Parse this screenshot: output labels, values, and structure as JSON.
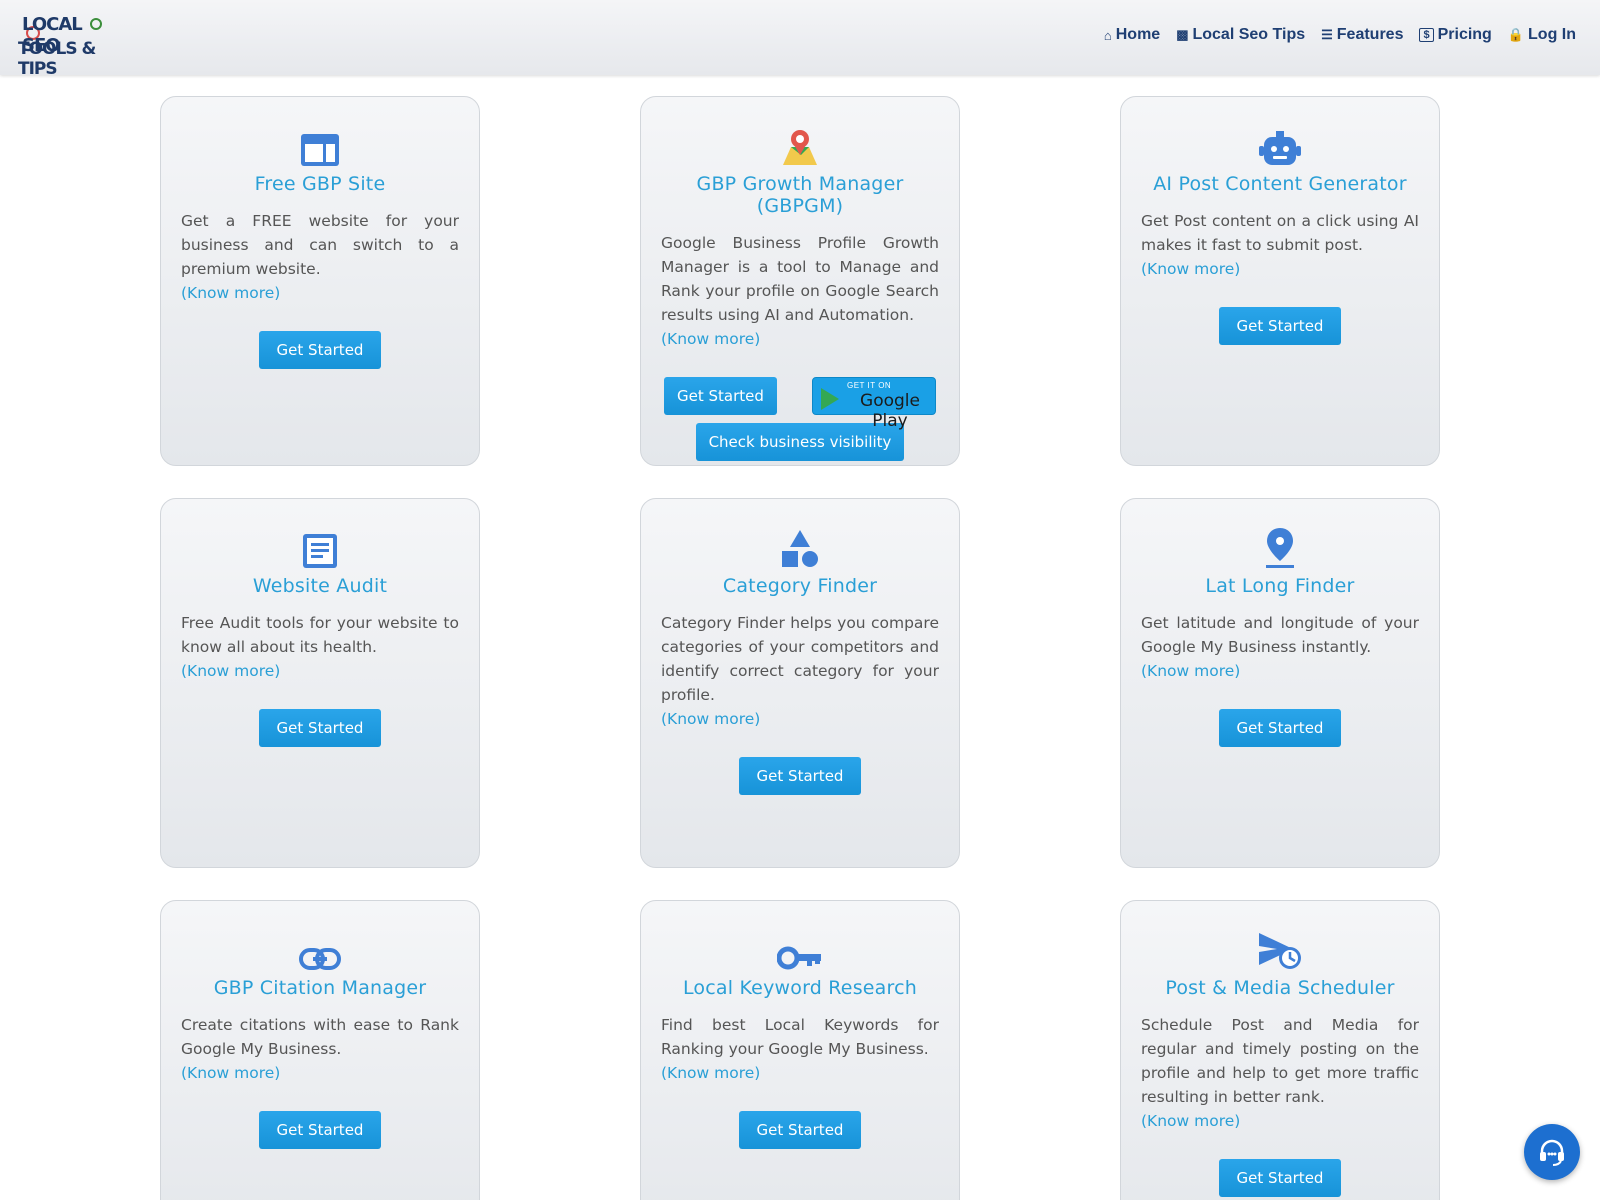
{
  "brand": {
    "line1": "LOCAL SEO",
    "line2": "TOOLS & TIPS"
  },
  "nav": [
    {
      "label": "Home",
      "icon": "home-icon"
    },
    {
      "label": "Local Seo Tips",
      "icon": "tips-icon"
    },
    {
      "label": "Features",
      "icon": "list-icon"
    },
    {
      "label": "Pricing",
      "icon": "dollar-icon"
    },
    {
      "label": "Log In",
      "icon": "lock-icon"
    }
  ],
  "know_more": "(Know more)",
  "get_started": "Get Started",
  "cards": [
    {
      "title": "Free GBP Site",
      "icon": "website-icon",
      "desc": "Get a FREE website for your business and can switch to a premium website."
    },
    {
      "title": "GBP Growth Manager (GBPGM)",
      "icon": "map-pin-icon",
      "desc": "Google Business Profile Growth Manager is a tool to Manage and Rank your profile on Google Search results using AI and Automation.",
      "play_small": "GET IT ON",
      "play_big": "Google Play",
      "extra_button": "Check business visibility"
    },
    {
      "title": "AI Post Content Generator",
      "icon": "robot-icon",
      "desc": "Get Post content on a click using AI makes it fast to submit post."
    },
    {
      "title": "Website Audit",
      "icon": "document-icon",
      "desc": "Free Audit tools for your website to know all about its health."
    },
    {
      "title": "Category Finder",
      "icon": "shapes-icon",
      "desc": "Category Finder helps you compare categories of your competitors and identify correct category for your profile."
    },
    {
      "title": "Lat Long Finder",
      "icon": "location-icon",
      "desc": "Get latitude and longitude of your Google My Business instantly."
    },
    {
      "title": "GBP Citation Manager",
      "icon": "link-icon",
      "desc": "Create citations with ease to Rank Google My Business."
    },
    {
      "title": "Local Keyword Research",
      "icon": "key-icon",
      "desc": "Find best Local Keywords for Ranking your Google My Business."
    },
    {
      "title": "Post & Media Scheduler",
      "icon": "schedule-send-icon",
      "desc": "Schedule Post and Media for regular and timely posting on the profile and help to get more traffic resulting in better rank."
    }
  ],
  "colors": {
    "accent": "#2a9fd6",
    "button": "#1f9be0",
    "nav_text": "#1f3f73",
    "icon_blue": "#3f7fd6"
  }
}
